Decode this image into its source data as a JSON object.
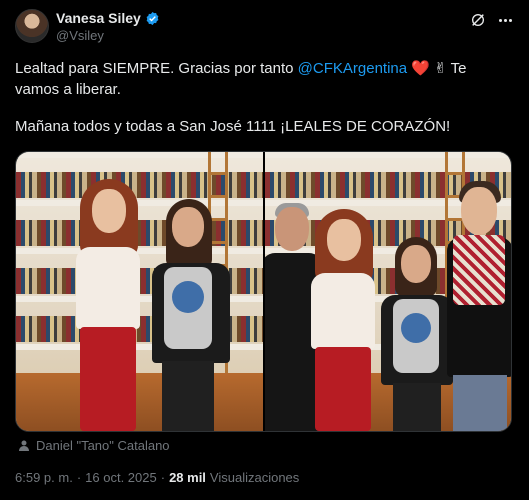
{
  "author": {
    "display_name": "Vanesa Siley",
    "handle": "@Vsiley"
  },
  "post": {
    "line1_a": "Lealtad para SIEMPRE. Gracias por tanto ",
    "mention": "@CFKArgentina",
    "heart": "❤️",
    "victory": "✌",
    "line1_b": " Te",
    "line2": "vamos a liberar.",
    "line3": "Mañana todos y todas a San José 1111 ¡LEALES DE CORAZÓN!"
  },
  "media": {
    "photo_count": 2,
    "tagged_user": "Daniel \"Tano\" Catalano"
  },
  "meta": {
    "time": "6:59 p. m.",
    "separator": "·",
    "date": "16 oct. 2025",
    "separator2": "·",
    "views_count": "28 mil",
    "views_label": "Visualizaciones"
  },
  "colors": {
    "background": "#000000",
    "text": "#e7e9ea",
    "muted": "#71767b",
    "link": "#1d9bf0",
    "verified": "#1d9bf0"
  },
  "icons": [
    "verified-badge-icon",
    "grok-icon",
    "more-icon",
    "person-tag-icon"
  ]
}
